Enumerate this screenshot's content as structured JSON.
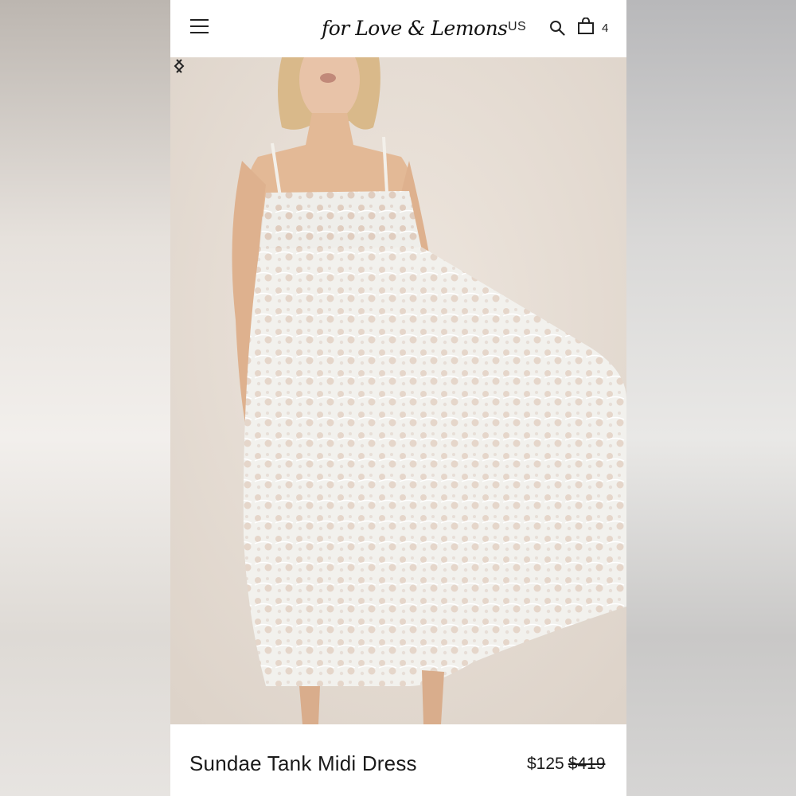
{
  "header": {
    "logo_text": "for Love & Lemons",
    "region": "US",
    "cart_count": "4",
    "icons": [
      "menu-icon",
      "search-icon",
      "shopping-bag-icon"
    ]
  },
  "gallery": {
    "image_alt": "Model wearing white lace midi dress",
    "prev_icon": "chevron-left-icon",
    "next_icon": "chevron-right-icon"
  },
  "product": {
    "title": "Sundae Tank Midi Dress",
    "sale_price": "$125",
    "original_price": "$419"
  },
  "colors": {
    "text": "#1a1a1a",
    "background": "#ffffff",
    "photo_background": "#e7dfd7"
  }
}
